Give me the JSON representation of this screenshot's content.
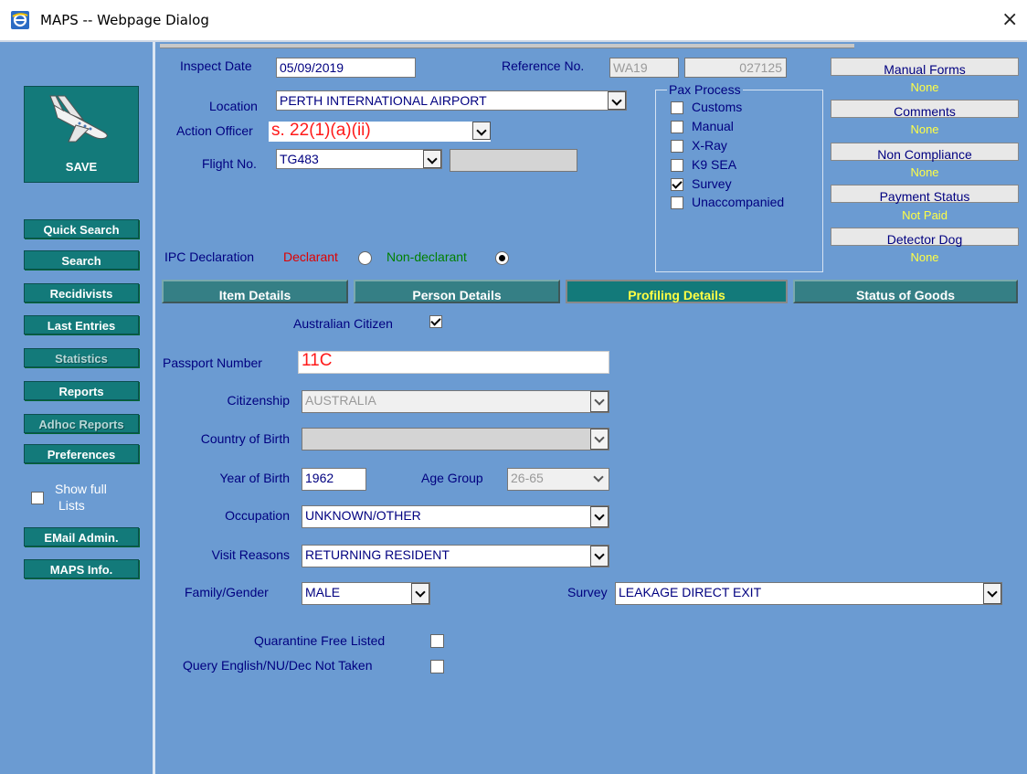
{
  "window": {
    "title": "MAPS -- Webpage Dialog",
    "close": "×"
  },
  "save": {
    "label": "SAVE"
  },
  "nav": [
    {
      "label": "Quick Search"
    },
    {
      "label": "Search"
    },
    {
      "label": "Recidivists"
    },
    {
      "label": "Last Entries"
    },
    {
      "label": "Statistics"
    },
    {
      "label": "Reports"
    },
    {
      "label": "Adhoc Reports"
    },
    {
      "label": "Preferences"
    },
    {
      "label": "EMail Admin."
    },
    {
      "label": "MAPS Info."
    }
  ],
  "show_full_lists": {
    "label1": "Show full",
    "label2": "Lists",
    "checked": false
  },
  "header": {
    "inspect_date": {
      "label": "Inspect Date",
      "value": "05/09/2019"
    },
    "reference": {
      "label": "Reference No.",
      "prefix": "WA19",
      "number": "027125"
    },
    "location": {
      "label": "Location",
      "value": "PERTH INTERNATIONAL AIRPORT"
    },
    "action_officer": {
      "label": "Action Officer",
      "value": "s. 22(1)(a)(ii)"
    },
    "flight": {
      "label": "Flight No.",
      "value": "TG483",
      "extra": ""
    }
  },
  "pax_process": {
    "title": "Pax Process",
    "items": [
      {
        "label": "Customs",
        "checked": false
      },
      {
        "label": "Manual",
        "checked": false
      },
      {
        "label": "X-Ray",
        "checked": false
      },
      {
        "label": "K9 SEA",
        "checked": false
      },
      {
        "label": "Survey",
        "checked": true
      },
      {
        "label": "Unaccompanied",
        "checked": false
      }
    ]
  },
  "right_panel": [
    {
      "button": "Manual Forms",
      "value": "None"
    },
    {
      "button": "Comments",
      "value": "None"
    },
    {
      "button": "Non Compliance",
      "value": "None"
    },
    {
      "button": "Payment Status",
      "value": "Not Paid"
    },
    {
      "button": "Detector Dog",
      "value": "None"
    }
  ],
  "ipc": {
    "label": "IPC Declaration",
    "declarant": "Declarant",
    "non_declarant": "Non-declarant",
    "selected": "non-declarant"
  },
  "tabs": [
    {
      "label": "Item Details"
    },
    {
      "label": "Person Details"
    },
    {
      "label": "Profiling Details",
      "active": true
    },
    {
      "label": "Status of Goods"
    }
  ],
  "profile": {
    "australian_citizen": {
      "label": "Australian Citizen",
      "checked": true
    },
    "passport": {
      "label": "Passport Number",
      "value": "11C"
    },
    "citizenship": {
      "label": "Citizenship",
      "value": "AUSTRALIA"
    },
    "country_of_birth": {
      "label": "Country of Birth",
      "value": ""
    },
    "year_of_birth": {
      "label": "Year of Birth",
      "value": "1962"
    },
    "age_group": {
      "label": "Age Group",
      "value": "26-65"
    },
    "occupation": {
      "label": "Occupation",
      "value": "UNKNOWN/OTHER"
    },
    "visit_reasons": {
      "label": "Visit Reasons",
      "value": "RETURNING RESIDENT"
    },
    "family_gender": {
      "label": "Family/Gender",
      "value": "MALE"
    },
    "survey": {
      "label": "Survey",
      "value": "LEAKAGE DIRECT EXIT"
    },
    "quarantine_free": {
      "label": "Quarantine Free Listed",
      "checked": false
    },
    "query_english": {
      "label": "Query English/NU/Dec Not Taken",
      "checked": false
    }
  },
  "colors": {
    "background": "#6b9bd2",
    "nav_button": "#137a7a",
    "accent_yellow": "#ffff44",
    "label_navy": "#000080"
  }
}
